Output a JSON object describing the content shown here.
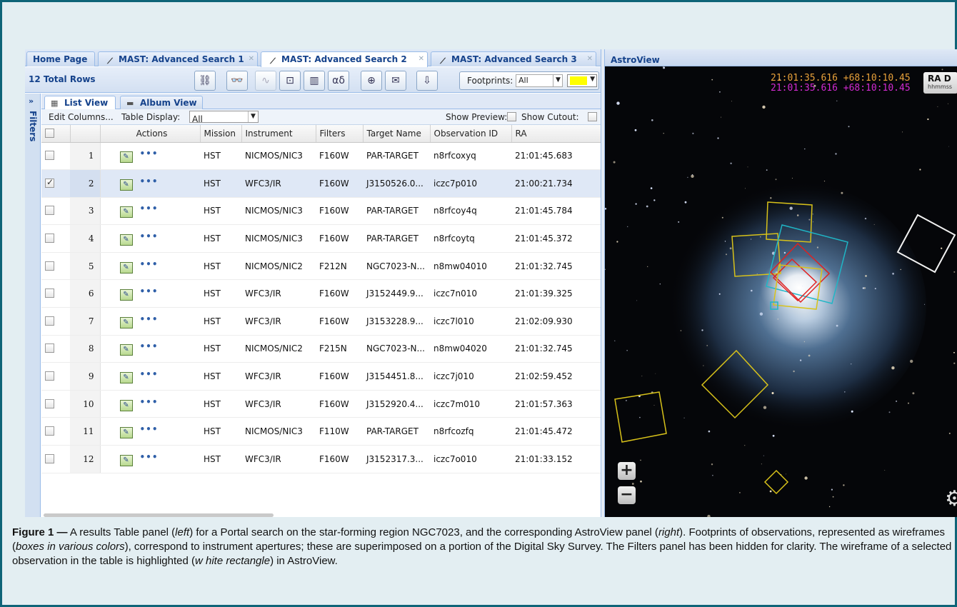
{
  "tabs": [
    {
      "label": "Home Page"
    },
    {
      "label": "MAST: Advanced Search 1"
    },
    {
      "label": "MAST: Advanced Search 2"
    },
    {
      "label": "MAST: Advanced Search 3"
    }
  ],
  "toolbar": {
    "total_rows": "12 Total Rows",
    "footprints_label": "Footprints:",
    "footprints_value": "All",
    "footprint_color": "#ffff00"
  },
  "filters": {
    "label": "Filters",
    "expand": "»"
  },
  "views": {
    "list": "List View",
    "album": "Album View"
  },
  "options": {
    "edit_columns": "Edit Columns...",
    "table_display_label": "Table Display:",
    "table_display_value": "All",
    "show_preview": "Show Preview:",
    "show_cutout": "Show Cutout:"
  },
  "columns": [
    "Actions",
    "Mission",
    "Instrument",
    "Filters",
    "Target Name",
    "Observation ID",
    "RA"
  ],
  "rows": [
    {
      "n": "1",
      "mission": "HST",
      "instrument": "NICMOS/NIC3",
      "filter": "F160W",
      "target": "PAR-TARGET",
      "obs": "n8rfcoxyq",
      "ra": "21:01:45.683",
      "checked": false
    },
    {
      "n": "2",
      "mission": "HST",
      "instrument": "WFC3/IR",
      "filter": "F160W",
      "target": "J3150526.0...",
      "obs": "iczc7p010",
      "ra": "21:00:21.734",
      "checked": true
    },
    {
      "n": "3",
      "mission": "HST",
      "instrument": "NICMOS/NIC3",
      "filter": "F160W",
      "target": "PAR-TARGET",
      "obs": "n8rfcoy4q",
      "ra": "21:01:45.784",
      "checked": false
    },
    {
      "n": "4",
      "mission": "HST",
      "instrument": "NICMOS/NIC3",
      "filter": "F160W",
      "target": "PAR-TARGET",
      "obs": "n8rfcoytq",
      "ra": "21:01:45.372",
      "checked": false
    },
    {
      "n": "5",
      "mission": "HST",
      "instrument": "NICMOS/NIC2",
      "filter": "F212N",
      "target": "NGC7023-N...",
      "obs": "n8mw04010",
      "ra": "21:01:32.745",
      "checked": false
    },
    {
      "n": "6",
      "mission": "HST",
      "instrument": "WFC3/IR",
      "filter": "F160W",
      "target": "J3152449.9...",
      "obs": "iczc7n010",
      "ra": "21:01:39.325",
      "checked": false
    },
    {
      "n": "7",
      "mission": "HST",
      "instrument": "WFC3/IR",
      "filter": "F160W",
      "target": "J3153228.9...",
      "obs": "iczc7l010",
      "ra": "21:02:09.930",
      "checked": false
    },
    {
      "n": "8",
      "mission": "HST",
      "instrument": "NICMOS/NIC2",
      "filter": "F215N",
      "target": "NGC7023-N...",
      "obs": "n8mw04020",
      "ra": "21:01:32.745",
      "checked": false
    },
    {
      "n": "9",
      "mission": "HST",
      "instrument": "WFC3/IR",
      "filter": "F160W",
      "target": "J3154451.8...",
      "obs": "iczc7j010",
      "ra": "21:02:59.452",
      "checked": false
    },
    {
      "n": "10",
      "mission": "HST",
      "instrument": "WFC3/IR",
      "filter": "F160W",
      "target": "J3152920.4...",
      "obs": "iczc7m010",
      "ra": "21:01:57.363",
      "checked": false
    },
    {
      "n": "11",
      "mission": "HST",
      "instrument": "NICMOS/NIC3",
      "filter": "F110W",
      "target": "PAR-TARGET",
      "obs": "n8rfcozfq",
      "ra": "21:01:45.472",
      "checked": false
    },
    {
      "n": "12",
      "mission": "HST",
      "instrument": "WFC3/IR",
      "filter": "F160W",
      "target": "J3152317.3...",
      "obs": "iczc7o010",
      "ra": "21:01:33.152",
      "checked": false
    }
  ],
  "astroview": {
    "title": "AstroView",
    "coord1": "21:01:35.616 +68:10:10.45",
    "coord2": "21:01:35.616 +68:10:10.45",
    "radec_label": "RA D",
    "radec_sub": "hhmmss",
    "zoom_in": "+",
    "zoom_out": "−"
  },
  "caption": {
    "fig": "Figure 1 —",
    "p1": " A results Table panel (",
    "i1": "left",
    "p2": ") for a Portal search on the star-forming region NGC7023, and the corresponding AstroView panel (",
    "i2": "right",
    "p3": "). Footprints of observations, represented as wireframes (",
    "i3": "boxes in various colors",
    "p4": "), correspond to instrument apertures; these are superimposed on a portion of the Digital Sky Survey. The Filters panel has been hidden for clarity. The wireframe of a selected observation in the table is highlighted (",
    "i4": "w hite rectangle",
    "p5": ") in AstroView."
  }
}
